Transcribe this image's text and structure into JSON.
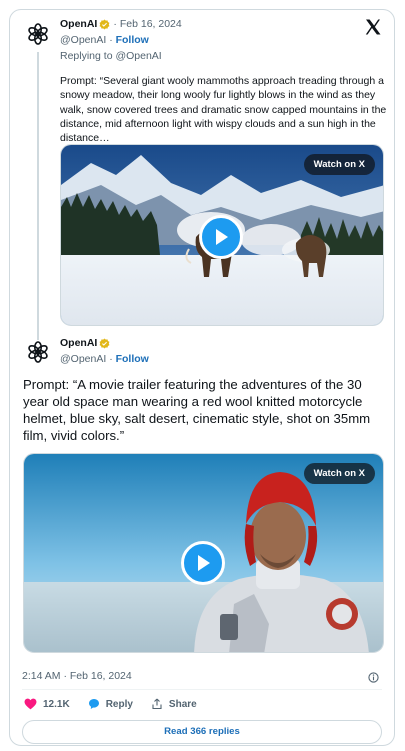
{
  "quoted_tweet": {
    "author_name": "OpenAI",
    "date_separator": "·",
    "date": "Feb 16, 2024",
    "handle": "@OpenAI",
    "handle_separator": "·",
    "follow_label": "Follow",
    "replying_to": "Replying to @OpenAI",
    "text": "Prompt: “Several giant wooly mammoths approach treading through a snowy meadow, their long wooly fur lightly blows in the wind as they walk, snow covered trees and dramatic snow capped mountains in the distance, mid afternoon light with wispy clouds and a sun high in the distance…",
    "watch_label": "Watch on X"
  },
  "main_tweet": {
    "author_name": "OpenAI",
    "handle": "@OpenAI",
    "handle_separator": "·",
    "follow_label": "Follow",
    "text": "Prompt: “A movie trailer featuring the adventures of the 30 year old space man wearing a red wool knitted motorcycle helmet, blue sky, salt desert, cinematic style, shot on 35mm film, vivid colors.”",
    "watch_label": "Watch on X",
    "timestamp": "2:14 AM · Feb 16, 2024",
    "like_count": "12.1K",
    "reply_label": "Reply",
    "share_label": "Share",
    "read_replies_label": "Read 366 replies"
  },
  "colors": {
    "link_blue": "#1d6fb8",
    "play_blue": "#1d9bf0",
    "like_pink": "#f91880",
    "verified_gold": "#e2b719"
  },
  "icons": [
    "openai-logo-icon",
    "verified-badge-icon",
    "x-logo-icon",
    "play-icon",
    "info-icon",
    "heart-icon",
    "reply-bubble-icon",
    "share-icon"
  ]
}
